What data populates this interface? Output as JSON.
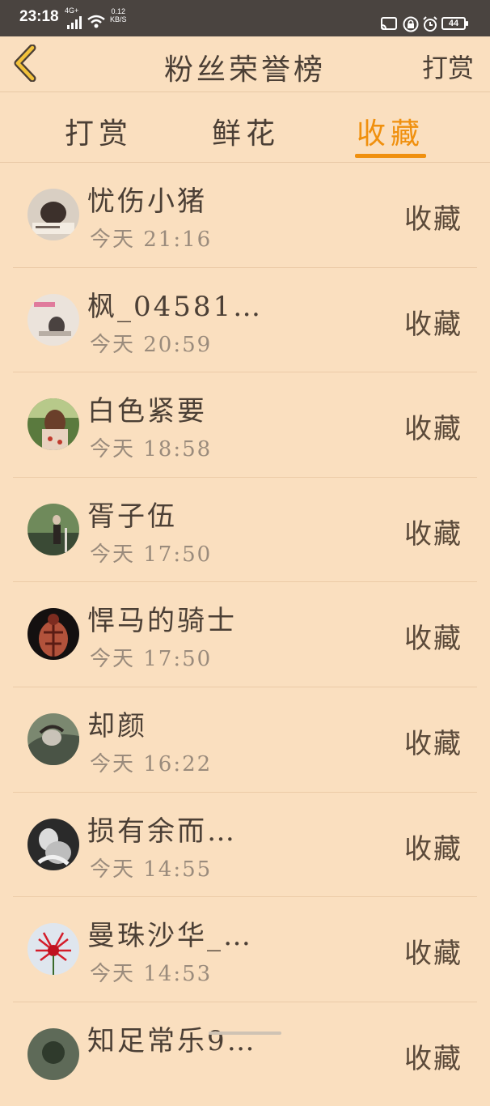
{
  "status_bar": {
    "time": "23:18",
    "network": "4G+",
    "speed_value": "0.12",
    "speed_unit": "KB/S",
    "battery": "44",
    "icons": [
      "signal-icon",
      "wifi-icon",
      "cast-icon",
      "lock-icon",
      "alarm-icon",
      "battery-icon"
    ]
  },
  "header": {
    "title": "粉丝荣誉榜",
    "action_label": "打赏"
  },
  "tabs": [
    {
      "label": "打赏",
      "active": false
    },
    {
      "label": "鲜花",
      "active": false
    },
    {
      "label": "收藏",
      "active": true
    }
  ],
  "accent_color": "#f0900e",
  "background_color": "#fadfbf",
  "fans": [
    {
      "name": "忧伤小猪",
      "time": "今天 21:16",
      "action": "收藏"
    },
    {
      "name": "枫_04581…",
      "time": "今天 20:59",
      "action": "收藏"
    },
    {
      "name": "白色紧要",
      "time": "今天 18:58",
      "action": "收藏"
    },
    {
      "name": "胥子伍",
      "time": "今天 17:50",
      "action": "收藏"
    },
    {
      "name": "悍马的骑士",
      "time": "今天 17:50",
      "action": "收藏"
    },
    {
      "name": "却颜",
      "time": "今天 16:22",
      "action": "收藏"
    },
    {
      "name": "损有余而…",
      "time": "今天 14:55",
      "action": "收藏"
    },
    {
      "name": "曼珠沙华_…",
      "time": "今天 14:53",
      "action": "收藏"
    },
    {
      "name": "知足常乐9…",
      "time": "",
      "action": "收藏"
    }
  ]
}
